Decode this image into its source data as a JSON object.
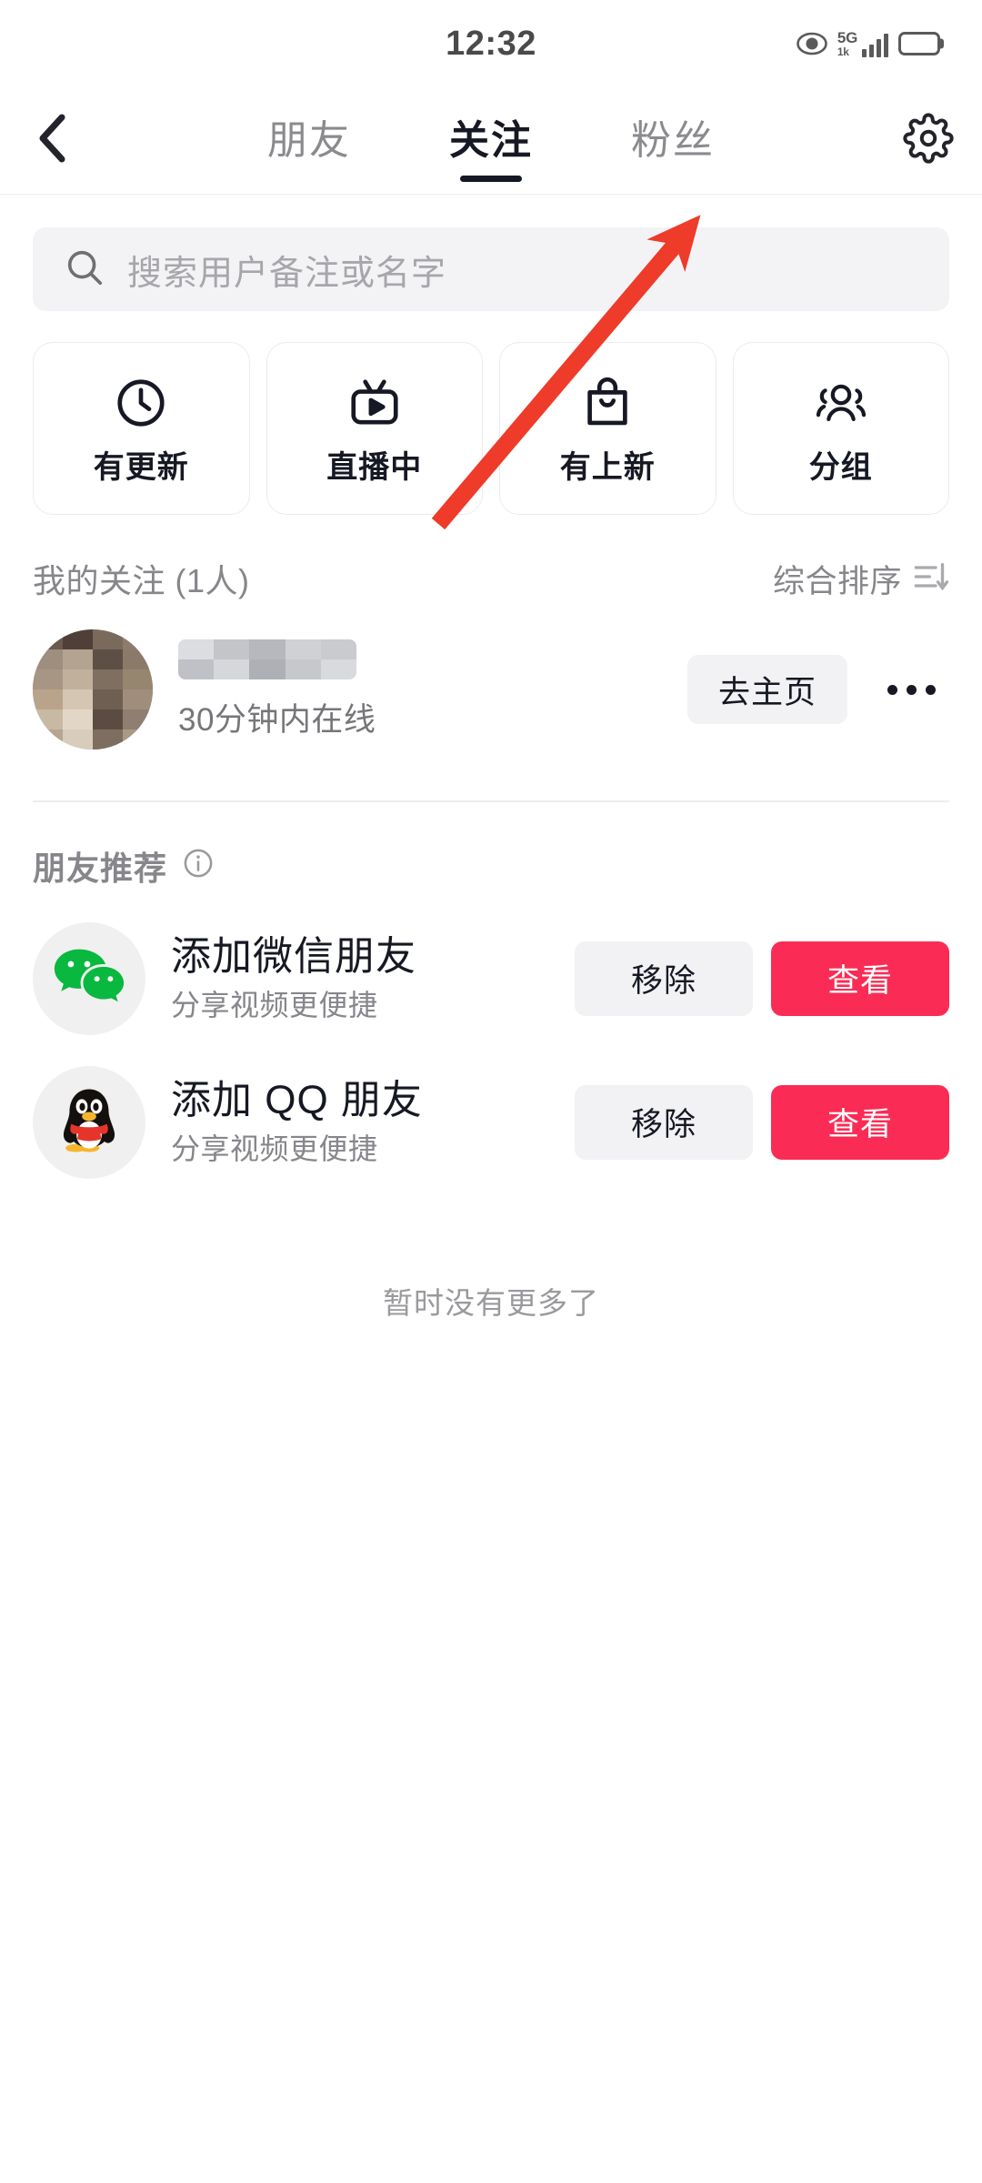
{
  "status_bar": {
    "time": "12:32",
    "eye_icon": "eye-icon",
    "network_type": "5G",
    "network_speed_label": "1k",
    "signal_icon": "signal-bars-icon",
    "battery_icon": "battery-full-icon"
  },
  "navbar": {
    "back_icon": "chevron-left-icon",
    "settings_icon": "gear-icon",
    "tabs": [
      {
        "label": "朋友",
        "active": false
      },
      {
        "label": "关注",
        "active": true
      },
      {
        "label": "粉丝",
        "active": false
      }
    ]
  },
  "search": {
    "icon": "search-icon",
    "placeholder": "搜索用户备注或名字",
    "value": ""
  },
  "quick_cards": [
    {
      "label": "有更新",
      "icon": "clock-icon"
    },
    {
      "label": "直播中",
      "icon": "live-tv-icon"
    },
    {
      "label": "有上新",
      "icon": "shopping-bag-icon"
    },
    {
      "label": "分组",
      "icon": "group-people-icon"
    }
  ],
  "following_section": {
    "title": "我的关注 (1人)",
    "sort_label": "综合排序",
    "sort_icon": "sort-filter-icon",
    "users": [
      {
        "name": "",
        "name_redacted": true,
        "avatar": "user-avatar-blurred",
        "status": "30分钟内在线",
        "primary_action": "去主页",
        "more_icon": "more-dots-icon"
      }
    ]
  },
  "recommend_section": {
    "title": "朋友推荐",
    "info_icon": "info-icon",
    "items": [
      {
        "icon": "wechat-icon",
        "name": "添加微信朋友",
        "subtitle": "分享视频更便捷",
        "remove_label": "移除",
        "view_label": "查看"
      },
      {
        "icon": "qq-penguin-icon",
        "name": "添加 QQ 朋友",
        "subtitle": "分享视频更便捷",
        "remove_label": "移除",
        "view_label": "查看"
      }
    ]
  },
  "footer": {
    "end_text": "暂时没有更多了"
  },
  "annotation": {
    "type": "arrow",
    "color": "#ee3b2a",
    "points_to": "粉丝"
  },
  "colors": {
    "accent_red": "#fa2c55",
    "annotation_red": "#ee3b2a",
    "text_primary": "#161823",
    "text_secondary": "#86868b",
    "surface_gray": "#f2f2f4",
    "wechat_green": "#09b83e"
  }
}
